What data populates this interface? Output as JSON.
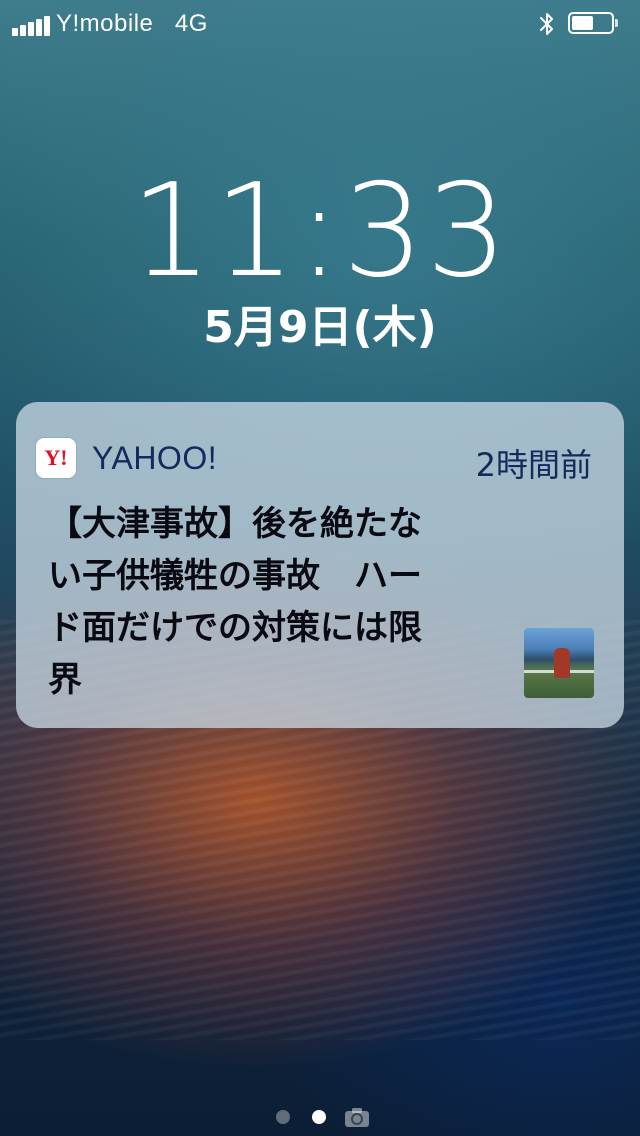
{
  "status_bar": {
    "carrier": "Y!mobile",
    "network": "4G",
    "signal_bars": 5,
    "bluetooth_icon": "bluetooth-icon",
    "battery_level": 0.55
  },
  "lock_screen": {
    "time": "11:33",
    "date": "5月9日(木)"
  },
  "notification": {
    "app_icon": "yahoo-app-icon",
    "app_icon_glyph": "Y!",
    "app_name": "YAHOO!",
    "time_ago": "2時間前",
    "body_lines": [
      "【大津事故】後を絶たな",
      "い子供犠牲の事故　ハー",
      "ド面だけでの対策には限",
      "界"
    ],
    "thumbnail": "news-thumbnail-image"
  },
  "page_indicator": {
    "pages": 2,
    "current": 1,
    "camera_icon": "camera-icon"
  },
  "colors": {
    "notification_background": "#c6d6e1",
    "app_name_color": "#142a5c",
    "yahoo_red": "#e0102b"
  }
}
